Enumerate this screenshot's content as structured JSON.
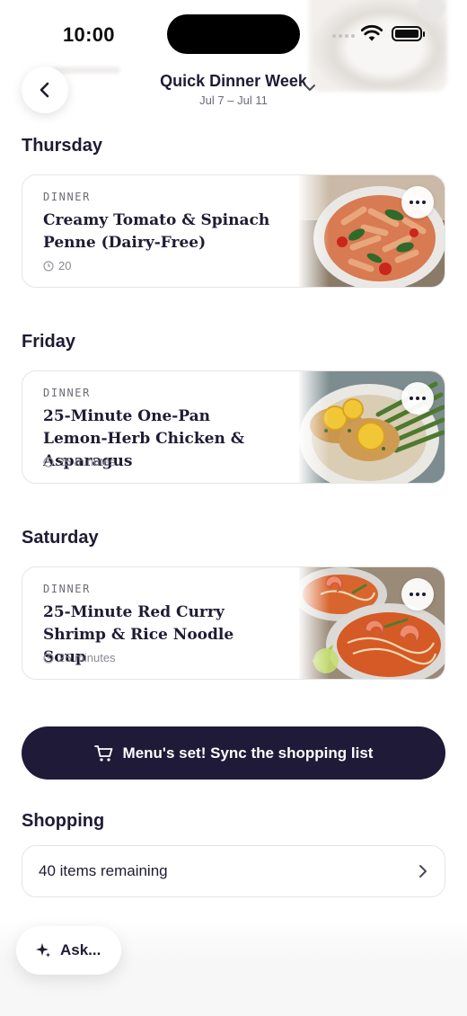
{
  "status_bar": {
    "time": "10:00"
  },
  "header": {
    "plan_title": "Quick Dinner Week",
    "date_range": "Jul 7 – Jul 11"
  },
  "days": [
    {
      "day": "Thursday",
      "meal": {
        "type": "DINNER",
        "title": "Creamy Tomato & Spinach Penne (Dairy-Free)",
        "time": "20",
        "photo": "penne-pasta-photo"
      }
    },
    {
      "day": "Friday",
      "meal": {
        "type": "DINNER",
        "title": "25-Minute One-Pan Lemon-Herb Chicken & Asparagus",
        "time": "25 minutes",
        "photo": "lemon-chicken-photo"
      }
    },
    {
      "day": "Saturday",
      "meal": {
        "type": "DINNER",
        "title": "25-Minute Red Curry Shrimp & Rice Noodle Soup",
        "time": "25 minutes",
        "photo": "curry-shrimp-soup-photo"
      }
    }
  ],
  "sync_button": {
    "label": "Menu's set! Sync the shopping list"
  },
  "shopping": {
    "heading": "Shopping",
    "summary": "40 items remaining"
  },
  "ask_button": {
    "label": "Ask..."
  },
  "colors": {
    "primary_dark": "#1e1a38",
    "text": "#1e1b33",
    "muted": "#6f6c74",
    "card_border": "#e7e5e3"
  }
}
